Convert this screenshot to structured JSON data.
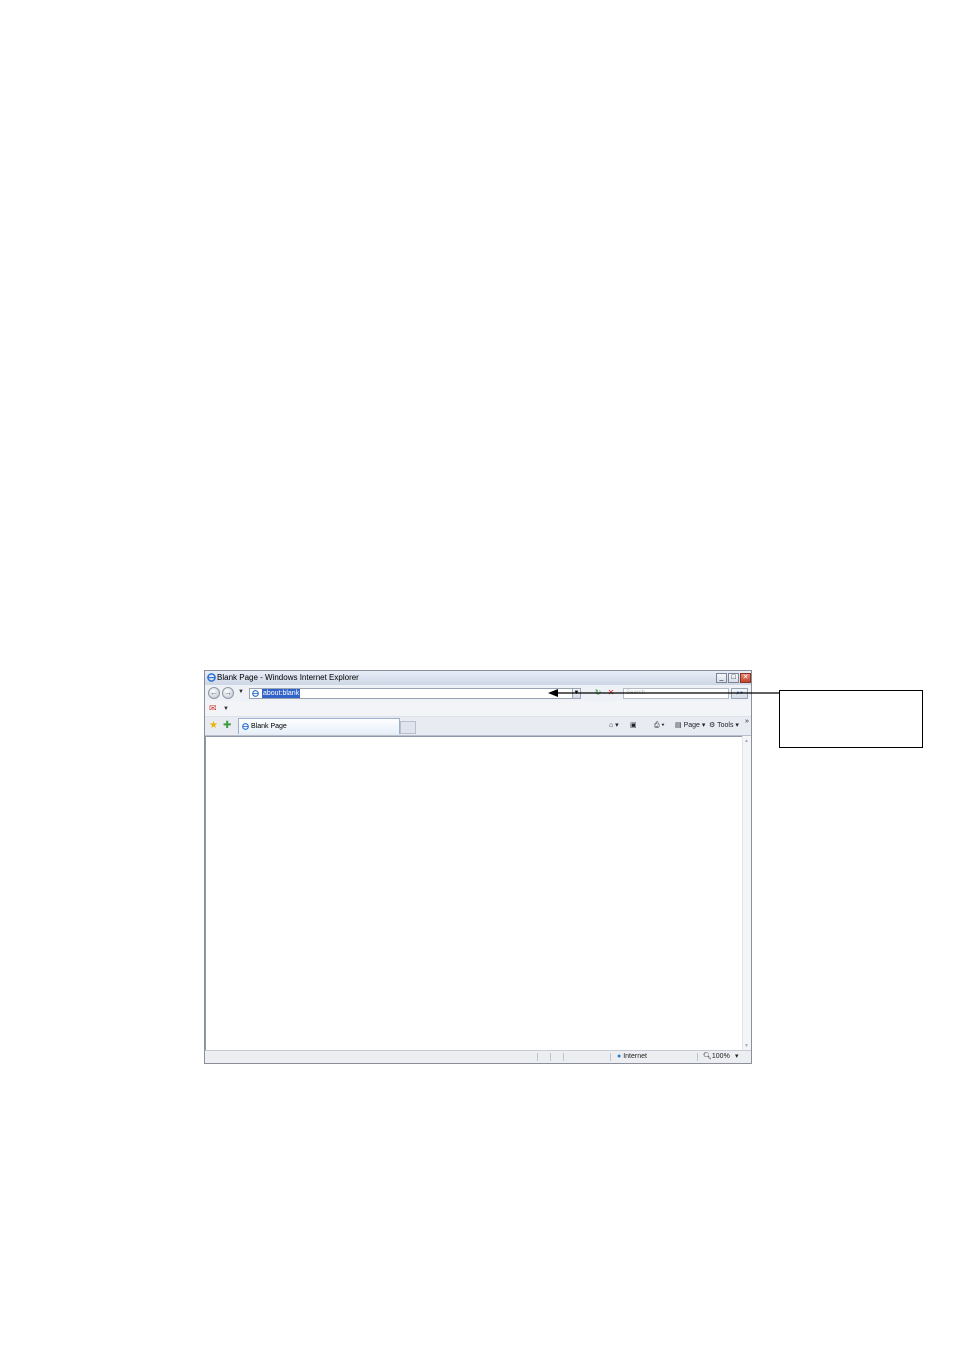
{
  "window": {
    "title": "Blank Page - Windows Internet Explorer",
    "minimize_glyph": "_",
    "maximize_glyph": "□",
    "close_glyph": "✕"
  },
  "address_bar": {
    "url": "about:blank",
    "search_placeholder": "Search"
  },
  "tab": {
    "label": "Blank Page"
  },
  "command_bar": {
    "page_label": "Page",
    "tools_label": "Tools",
    "more_glyph": "»"
  },
  "status_bar": {
    "zone": "Internet",
    "zoom": "100%"
  },
  "colors": {
    "address_highlight": "#3163c9",
    "tab_border": "#9bb0cf"
  }
}
